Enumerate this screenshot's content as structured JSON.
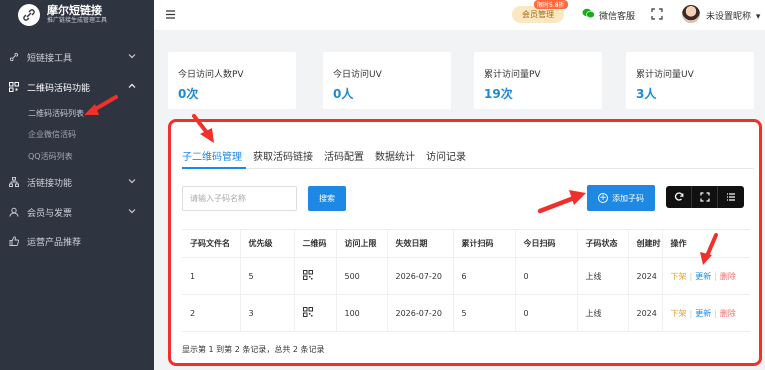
{
  "app": {
    "brand_title": "摩尔短链接",
    "brand_subtitle": "推广链接生成管理工具"
  },
  "sidebar": {
    "items": [
      {
        "label": "短链接工具",
        "icon": "link-icon"
      },
      {
        "label": "二维码活码功能",
        "icon": "qrcode-icon"
      },
      {
        "label": "活链接功能",
        "icon": "sitemap-icon"
      },
      {
        "label": "会员与发票",
        "icon": "user-icon"
      },
      {
        "label": "运营产品推荐",
        "icon": "thumbs-up-icon"
      }
    ],
    "subitems": [
      {
        "label": "二维码活码列表"
      },
      {
        "label": "企业微信活码"
      },
      {
        "label": "QQ活码列表"
      }
    ]
  },
  "header": {
    "vip_label": "会员管理",
    "sale_badge": "限时5.8折",
    "wechat_label": "微信客服",
    "username": "未设置昵称"
  },
  "stats": [
    {
      "label": "今日访问人数PV",
      "value": "0次"
    },
    {
      "label": "今日访问UV",
      "value": "0人"
    },
    {
      "label": "累计访问量PV",
      "value": "19次"
    },
    {
      "label": "累计访问量UV",
      "value": "3人"
    }
  ],
  "tabs": [
    {
      "label": "子二维码管理"
    },
    {
      "label": "获取活码链接"
    },
    {
      "label": "活码配置"
    },
    {
      "label": "数据统计"
    },
    {
      "label": "访问记录"
    }
  ],
  "toolbar": {
    "search_placeholder": "请输入子码名称",
    "search_label": "搜索",
    "add_label": "添加子码"
  },
  "table": {
    "headers": [
      "子码文件名",
      "优先级",
      "二维码",
      "访问上限",
      "失效日期",
      "累计扫码",
      "今日扫码",
      "子码状态",
      "创建时",
      "操作"
    ],
    "rows": [
      {
        "name": "1",
        "priority": "5",
        "limit": "500",
        "expire": "2026-07-20",
        "total": "6",
        "today": "0",
        "status": "上线",
        "created": "2024",
        "act_down": "下架",
        "act_update": "更新",
        "act_delete": "删除"
      },
      {
        "name": "2",
        "priority": "3",
        "limit": "100",
        "expire": "2026-07-20",
        "total": "5",
        "today": "0",
        "status": "上线",
        "created": "2024",
        "act_down": "下架",
        "act_update": "更新",
        "act_delete": "删除"
      }
    ]
  },
  "footer": {
    "summary": "显示第 1 到第 2 条记录，总共 2 条记录"
  },
  "colors": {
    "accent": "#1e88e5",
    "highlight": "#f0312b",
    "sidebar_bg": "#2f3441"
  }
}
